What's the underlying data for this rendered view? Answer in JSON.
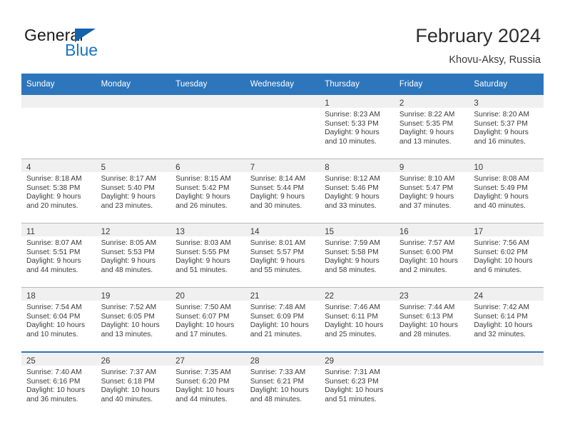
{
  "brand": {
    "word1": "General",
    "word2": "Blue",
    "flag_icon": "triangle-flag-icon",
    "accent_color": "#1975c4"
  },
  "header": {
    "month_title": "February 2024",
    "location": "Khovu-Aksy, Russia"
  },
  "calendar": {
    "header_bg": "#2e76bc",
    "daynum_band_bg": "#f0f0f0",
    "weekday_headers": [
      "Sunday",
      "Monday",
      "Tuesday",
      "Wednesday",
      "Thursday",
      "Friday",
      "Saturday"
    ],
    "weeks": [
      [
        {
          "day": "",
          "empty": true
        },
        {
          "day": "",
          "empty": true
        },
        {
          "day": "",
          "empty": true
        },
        {
          "day": "",
          "empty": true
        },
        {
          "day": "1",
          "sunrise": "Sunrise: 8:23 AM",
          "sunset": "Sunset: 5:33 PM",
          "daylight": "Daylight: 9 hours and 10 minutes."
        },
        {
          "day": "2",
          "sunrise": "Sunrise: 8:22 AM",
          "sunset": "Sunset: 5:35 PM",
          "daylight": "Daylight: 9 hours and 13 minutes."
        },
        {
          "day": "3",
          "sunrise": "Sunrise: 8:20 AM",
          "sunset": "Sunset: 5:37 PM",
          "daylight": "Daylight: 9 hours and 16 minutes."
        }
      ],
      [
        {
          "day": "4",
          "sunrise": "Sunrise: 8:18 AM",
          "sunset": "Sunset: 5:38 PM",
          "daylight": "Daylight: 9 hours and 20 minutes."
        },
        {
          "day": "5",
          "sunrise": "Sunrise: 8:17 AM",
          "sunset": "Sunset: 5:40 PM",
          "daylight": "Daylight: 9 hours and 23 minutes."
        },
        {
          "day": "6",
          "sunrise": "Sunrise: 8:15 AM",
          "sunset": "Sunset: 5:42 PM",
          "daylight": "Daylight: 9 hours and 26 minutes."
        },
        {
          "day": "7",
          "sunrise": "Sunrise: 8:14 AM",
          "sunset": "Sunset: 5:44 PM",
          "daylight": "Daylight: 9 hours and 30 minutes."
        },
        {
          "day": "8",
          "sunrise": "Sunrise: 8:12 AM",
          "sunset": "Sunset: 5:46 PM",
          "daylight": "Daylight: 9 hours and 33 minutes."
        },
        {
          "day": "9",
          "sunrise": "Sunrise: 8:10 AM",
          "sunset": "Sunset: 5:47 PM",
          "daylight": "Daylight: 9 hours and 37 minutes."
        },
        {
          "day": "10",
          "sunrise": "Sunrise: 8:08 AM",
          "sunset": "Sunset: 5:49 PM",
          "daylight": "Daylight: 9 hours and 40 minutes."
        }
      ],
      [
        {
          "day": "11",
          "sunrise": "Sunrise: 8:07 AM",
          "sunset": "Sunset: 5:51 PM",
          "daylight": "Daylight: 9 hours and 44 minutes."
        },
        {
          "day": "12",
          "sunrise": "Sunrise: 8:05 AM",
          "sunset": "Sunset: 5:53 PM",
          "daylight": "Daylight: 9 hours and 48 minutes."
        },
        {
          "day": "13",
          "sunrise": "Sunrise: 8:03 AM",
          "sunset": "Sunset: 5:55 PM",
          "daylight": "Daylight: 9 hours and 51 minutes."
        },
        {
          "day": "14",
          "sunrise": "Sunrise: 8:01 AM",
          "sunset": "Sunset: 5:57 PM",
          "daylight": "Daylight: 9 hours and 55 minutes."
        },
        {
          "day": "15",
          "sunrise": "Sunrise: 7:59 AM",
          "sunset": "Sunset: 5:58 PM",
          "daylight": "Daylight: 9 hours and 58 minutes."
        },
        {
          "day": "16",
          "sunrise": "Sunrise: 7:57 AM",
          "sunset": "Sunset: 6:00 PM",
          "daylight": "Daylight: 10 hours and 2 minutes."
        },
        {
          "day": "17",
          "sunrise": "Sunrise: 7:56 AM",
          "sunset": "Sunset: 6:02 PM",
          "daylight": "Daylight: 10 hours and 6 minutes."
        }
      ],
      [
        {
          "day": "18",
          "sunrise": "Sunrise: 7:54 AM",
          "sunset": "Sunset: 6:04 PM",
          "daylight": "Daylight: 10 hours and 10 minutes."
        },
        {
          "day": "19",
          "sunrise": "Sunrise: 7:52 AM",
          "sunset": "Sunset: 6:05 PM",
          "daylight": "Daylight: 10 hours and 13 minutes."
        },
        {
          "day": "20",
          "sunrise": "Sunrise: 7:50 AM",
          "sunset": "Sunset: 6:07 PM",
          "daylight": "Daylight: 10 hours and 17 minutes."
        },
        {
          "day": "21",
          "sunrise": "Sunrise: 7:48 AM",
          "sunset": "Sunset: 6:09 PM",
          "daylight": "Daylight: 10 hours and 21 minutes."
        },
        {
          "day": "22",
          "sunrise": "Sunrise: 7:46 AM",
          "sunset": "Sunset: 6:11 PM",
          "daylight": "Daylight: 10 hours and 25 minutes."
        },
        {
          "day": "23",
          "sunrise": "Sunrise: 7:44 AM",
          "sunset": "Sunset: 6:13 PM",
          "daylight": "Daylight: 10 hours and 28 minutes."
        },
        {
          "day": "24",
          "sunrise": "Sunrise: 7:42 AM",
          "sunset": "Sunset: 6:14 PM",
          "daylight": "Daylight: 10 hours and 32 minutes."
        }
      ],
      [
        {
          "day": "25",
          "sunrise": "Sunrise: 7:40 AM",
          "sunset": "Sunset: 6:16 PM",
          "daylight": "Daylight: 10 hours and 36 minutes."
        },
        {
          "day": "26",
          "sunrise": "Sunrise: 7:37 AM",
          "sunset": "Sunset: 6:18 PM",
          "daylight": "Daylight: 10 hours and 40 minutes."
        },
        {
          "day": "27",
          "sunrise": "Sunrise: 7:35 AM",
          "sunset": "Sunset: 6:20 PM",
          "daylight": "Daylight: 10 hours and 44 minutes."
        },
        {
          "day": "28",
          "sunrise": "Sunrise: 7:33 AM",
          "sunset": "Sunset: 6:21 PM",
          "daylight": "Daylight: 10 hours and 48 minutes."
        },
        {
          "day": "29",
          "sunrise": "Sunrise: 7:31 AM",
          "sunset": "Sunset: 6:23 PM",
          "daylight": "Daylight: 10 hours and 51 minutes."
        },
        {
          "day": "",
          "empty": true
        },
        {
          "day": "",
          "empty": true
        }
      ]
    ]
  }
}
